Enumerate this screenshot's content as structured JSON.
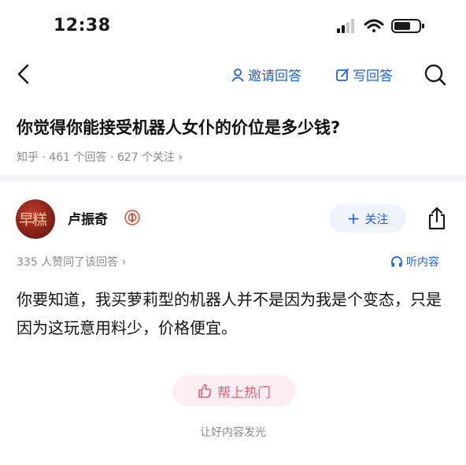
{
  "status_bar": {
    "time": "12:38"
  },
  "nav": {
    "invite_label": "邀请回答",
    "write_label": "写回答"
  },
  "question": {
    "title": "你觉得你能接受机器人女仆的价位是多少钱?",
    "source": "知乎",
    "answers": "461 个回答",
    "followers": "627 个关注"
  },
  "author": {
    "name": "卢振奇",
    "avatar_text": "早糕",
    "follow_label": "关注"
  },
  "answer": {
    "likes": "335 人赞同了该回答",
    "listen_label": "听内容",
    "body": "你要知道，我买萝莉型的机器人并不是因为我是个变态，只是因为这玩意用料少，价格便宜。"
  },
  "footer": {
    "hot_label": "帮上热门",
    "hot_sub": "让好内容发光"
  },
  "colors": {
    "accent": "#1f62e0",
    "hot": "#ea5b7a",
    "meta": "#8a8a8a"
  }
}
